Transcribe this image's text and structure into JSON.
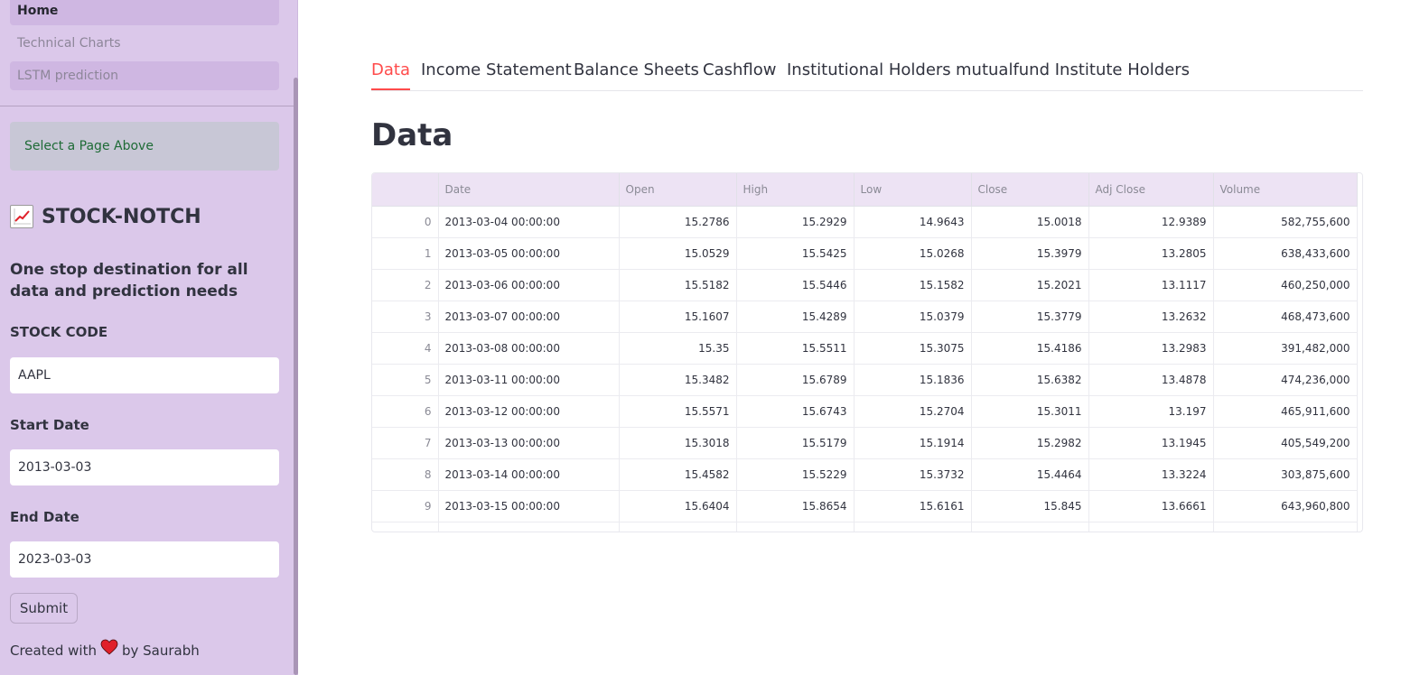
{
  "sidebar": {
    "nav": [
      "Home",
      "Technical Charts",
      "LSTM prediction"
    ],
    "info": "Select a Page Above",
    "brand_title": "STOCK-NOTCH",
    "brand_icon": "chart-increasing-icon",
    "tagline": "One stop destination for all data and prediction needs",
    "stock_code_label": "STOCK CODE",
    "stock_code_value": "AAPL",
    "start_date_label": "Start Date",
    "start_date_value": "2013-03-03",
    "end_date_label": "End Date",
    "end_date_value": "2023-03-03",
    "submit_label": "Submit",
    "footer_prefix": "Created with",
    "footer_suffix": "by Saurabh"
  },
  "main": {
    "tabs": [
      "Data",
      "Income Statement",
      "Balance Sheets",
      "Cashflow",
      "Institutional Holders",
      "mutualfund Institute Holders"
    ],
    "active_tab": "Data",
    "title": "Data",
    "table": {
      "columns": [
        "",
        "Date",
        "Open",
        "High",
        "Low",
        "Close",
        "Adj Close",
        "Volume"
      ],
      "rows": [
        [
          "0",
          "2013-03-04 00:00:00",
          "15.2786",
          "15.2929",
          "14.9643",
          "15.0018",
          "12.9389",
          "582,755,600"
        ],
        [
          "1",
          "2013-03-05 00:00:00",
          "15.0529",
          "15.5425",
          "15.0268",
          "15.3979",
          "13.2805",
          "638,433,600"
        ],
        [
          "2",
          "2013-03-06 00:00:00",
          "15.5182",
          "15.5446",
          "15.1582",
          "15.2021",
          "13.1117",
          "460,250,000"
        ],
        [
          "3",
          "2013-03-07 00:00:00",
          "15.1607",
          "15.4289",
          "15.0379",
          "15.3779",
          "13.2632",
          "468,473,600"
        ],
        [
          "4",
          "2013-03-08 00:00:00",
          "15.35",
          "15.5511",
          "15.3075",
          "15.4186",
          "13.2983",
          "391,482,000"
        ],
        [
          "5",
          "2013-03-11 00:00:00",
          "15.3482",
          "15.6789",
          "15.1836",
          "15.6382",
          "13.4878",
          "474,236,000"
        ],
        [
          "6",
          "2013-03-12 00:00:00",
          "15.5571",
          "15.6743",
          "15.2704",
          "15.3011",
          "13.197",
          "465,911,600"
        ],
        [
          "7",
          "2013-03-13 00:00:00",
          "15.3018",
          "15.5179",
          "15.1914",
          "15.2982",
          "13.1945",
          "405,549,200"
        ],
        [
          "8",
          "2013-03-14 00:00:00",
          "15.4582",
          "15.5229",
          "15.3732",
          "15.4464",
          "13.3224",
          "303,875,600"
        ],
        [
          "9",
          "2013-03-15 00:00:00",
          "15.6404",
          "15.8654",
          "15.6161",
          "15.845",
          "13.6661",
          "643,960,800"
        ]
      ]
    }
  },
  "colors": {
    "sidebar_bg": "#dbc8ea",
    "accent": "#ff4b4b",
    "info_text": "#1e6b36",
    "heart": "#e0202a"
  }
}
